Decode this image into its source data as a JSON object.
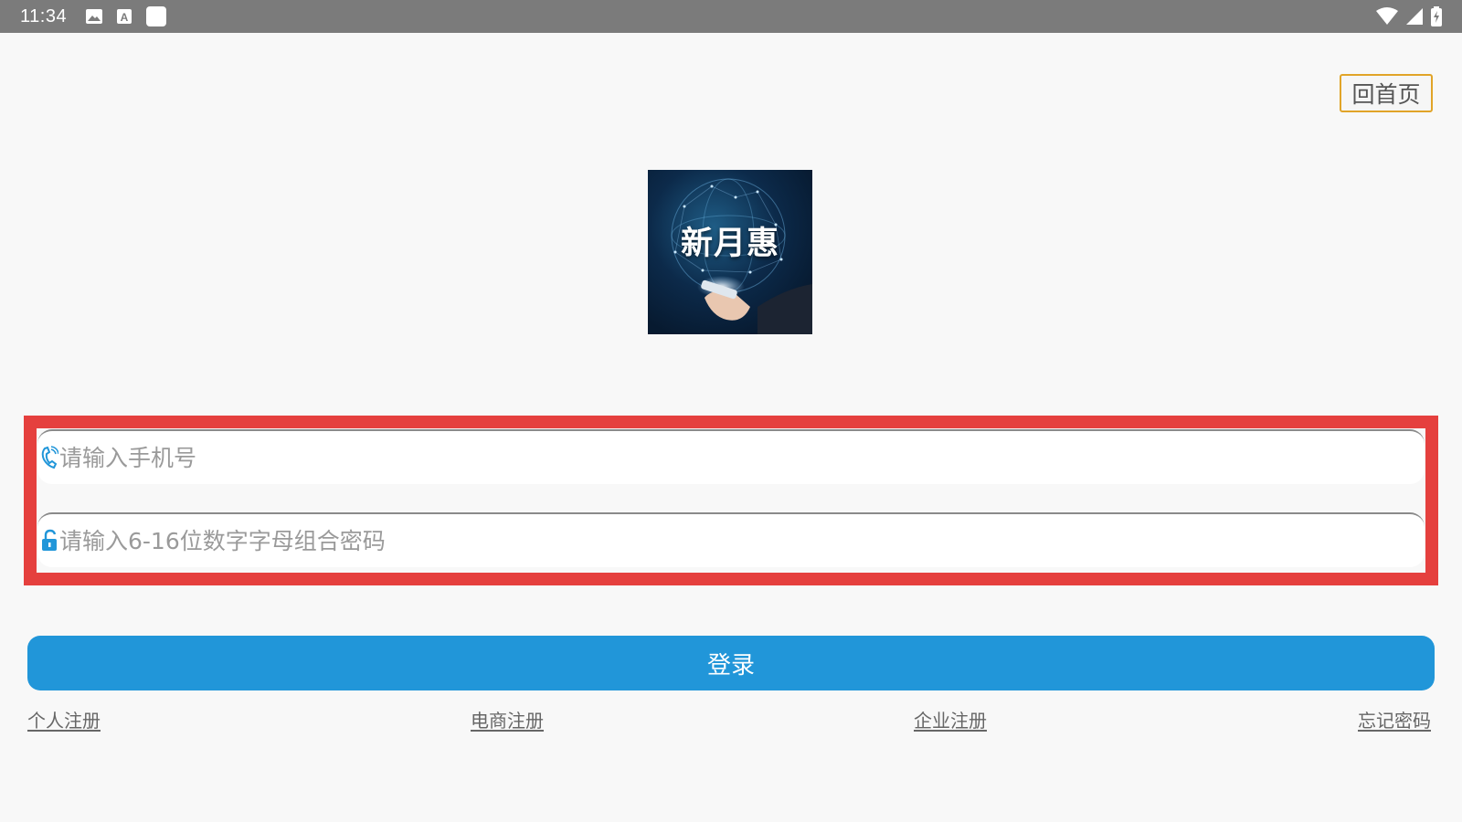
{
  "status_bar": {
    "time": "11:34",
    "icons": [
      "image-icon",
      "text-a-icon",
      "square-app-icon",
      "wifi-icon",
      "signal-icon",
      "battery-charging-icon"
    ]
  },
  "header": {
    "home_label": "回首页"
  },
  "logo": {
    "text": "新月惠"
  },
  "form": {
    "phone_placeholder": "请输入手机号",
    "password_placeholder": "请输入6-16位数字字母组合密码",
    "highlight_color": "#e5403e"
  },
  "actions": {
    "login_label": "登录"
  },
  "links": {
    "personal_register": "个人注册",
    "ecommerce_register": "电商注册",
    "enterprise_register": "企业注册",
    "forgot_password": "忘记密码"
  },
  "colors": {
    "primary": "#2196d9",
    "home_border": "#e1a428",
    "status_bar": "#7b7b7b",
    "background": "#f8f8f8"
  }
}
